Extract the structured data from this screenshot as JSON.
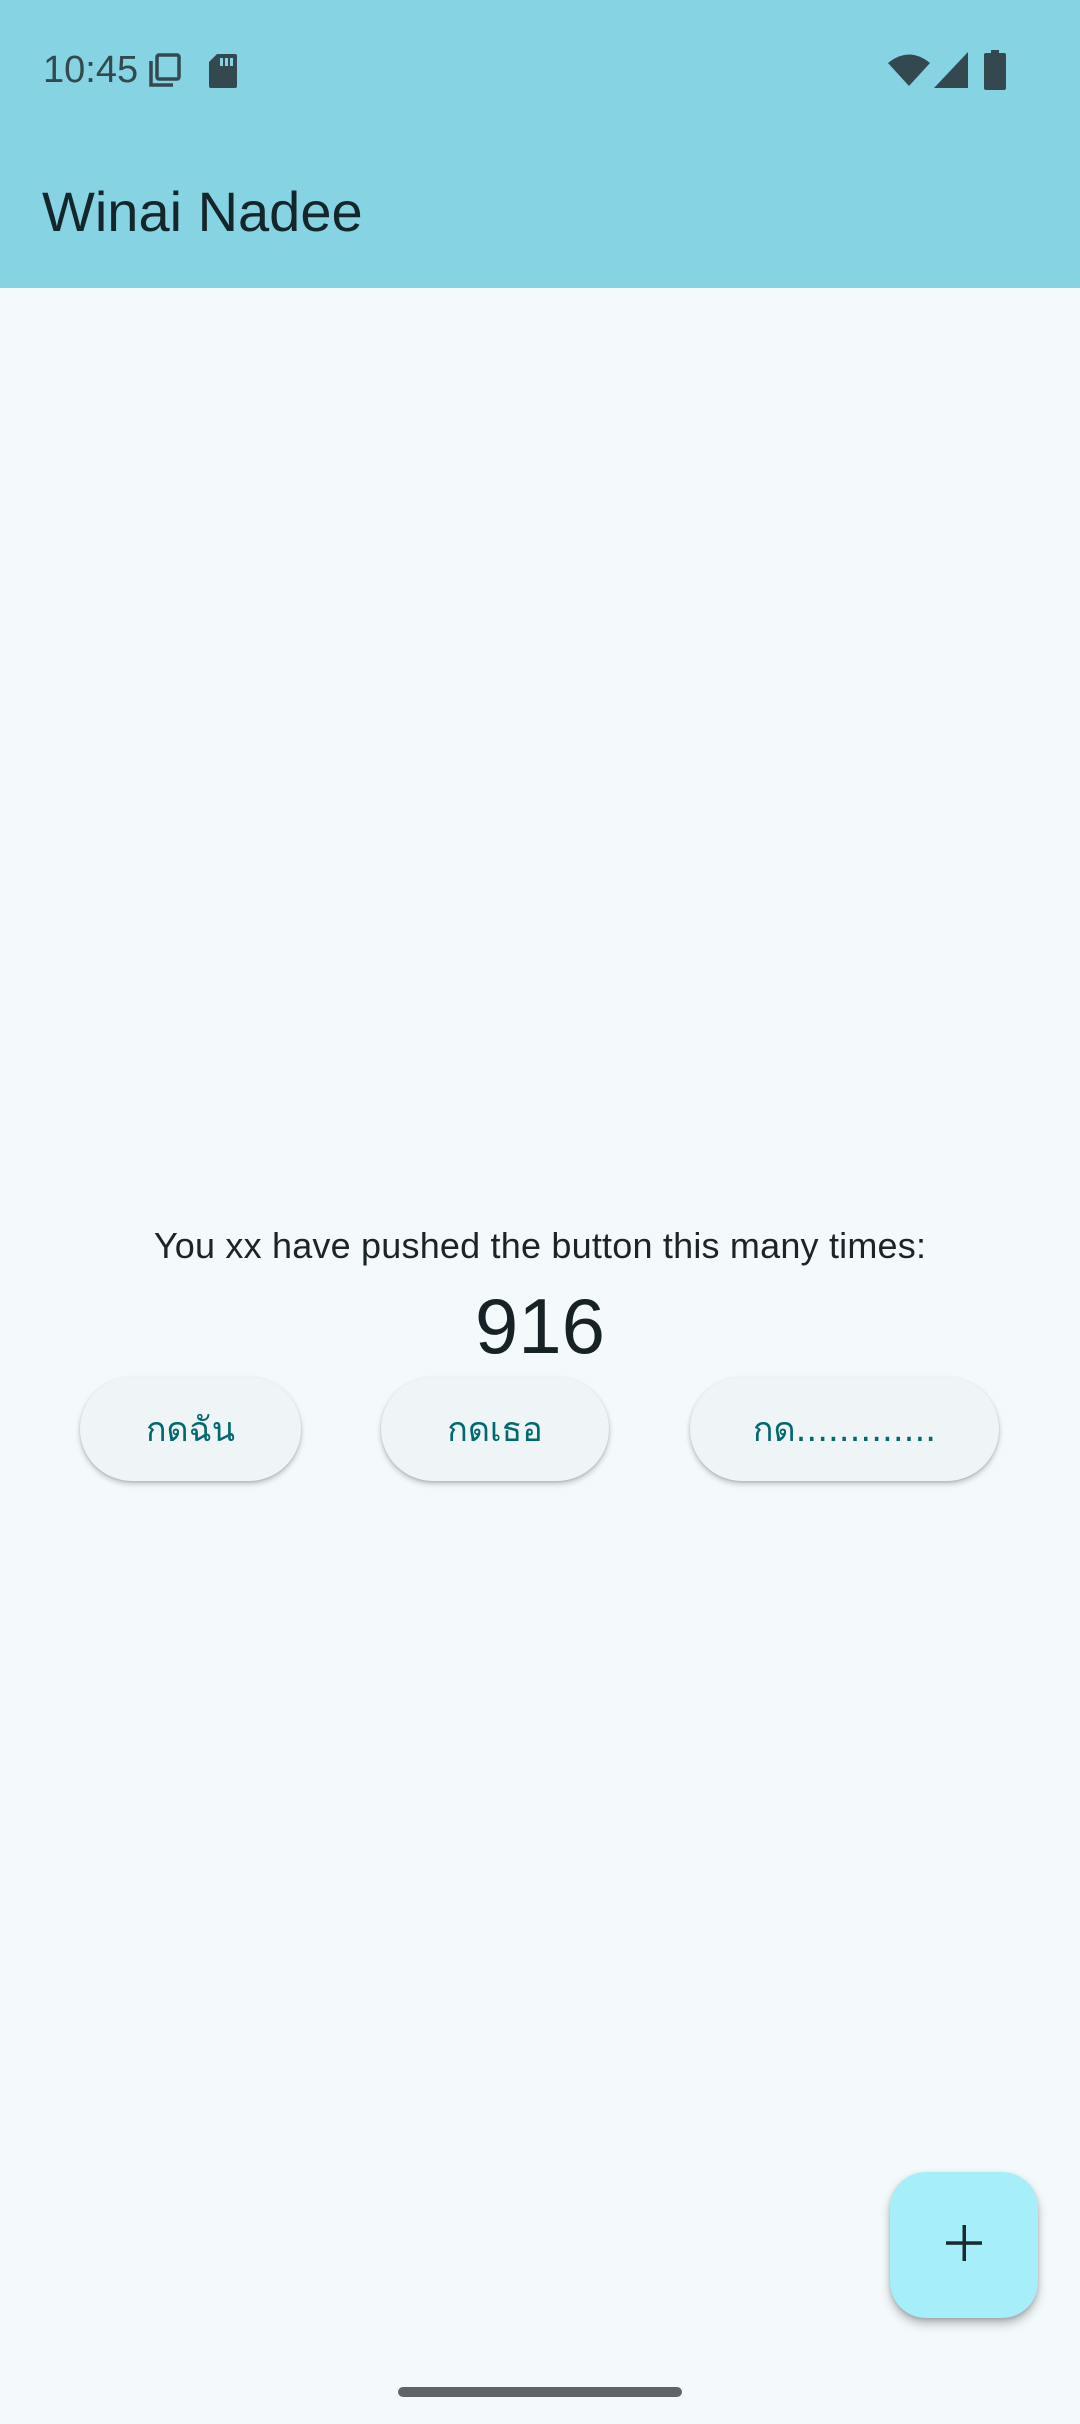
{
  "status_bar": {
    "time": "10:45",
    "icons": [
      "notification-copy-icon",
      "sd-card-icon",
      "wifi-icon",
      "cell-signal-icon",
      "battery-icon"
    ]
  },
  "app_bar": {
    "title": "Winai Nadee"
  },
  "body": {
    "message": "You xx have pushed the button this many times:",
    "counter": "916",
    "buttons": [
      {
        "label": "กดฉัน"
      },
      {
        "label": "กดเธอ"
      },
      {
        "label": "กด............."
      }
    ]
  },
  "fab": {
    "icon": "plus-icon"
  },
  "colors": {
    "app_bar": "#86d3e3",
    "background": "#f4fafc",
    "button_text": "#00686f",
    "fab": "#a6eef9"
  }
}
